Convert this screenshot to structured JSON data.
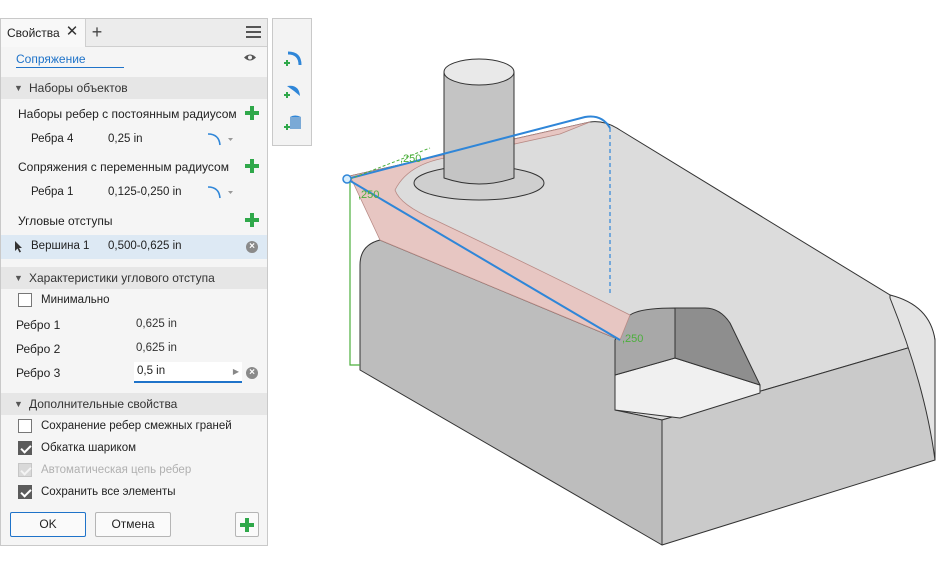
{
  "panel": {
    "tab_label": "Свойства",
    "close_glyph": "✕",
    "add_glyph": "+",
    "feature_name": "Сопряжение",
    "sections": {
      "object_sets": "Наборы объектов",
      "corner_setback": "Характеристики углового отступа",
      "advanced": "Дополнительные свойства"
    },
    "const_radius": {
      "title": "Наборы ребер с постоянным радиусом",
      "edge_label": "Ребра 4",
      "edge_value": "0,25 in"
    },
    "var_radius": {
      "title": "Сопряжения с переменным радиусом",
      "edge_label": "Ребра 1",
      "edge_value": "0,125-0,250 in"
    },
    "setbacks": {
      "title": "Угловые отступы",
      "vertex_label": "Вершина 1",
      "vertex_value": "0,500-0,625 in"
    },
    "corner": {
      "minimal_label": "Минимально",
      "minimal_checked": false,
      "edge1_label": "Ребро 1",
      "edge1_value": "0,625 in",
      "edge2_label": "Ребро 2",
      "edge2_value": "0,625 in",
      "edge3_label": "Ребро 3",
      "edge3_value": "0,5 in"
    },
    "advanced": {
      "preserve_edges_label": "Сохранение ребер смежных граней",
      "preserve_edges_checked": false,
      "rolling_ball_label": "Обкатка шариком",
      "rolling_ball_checked": true,
      "auto_chain_label": "Автоматическая цепь ребер",
      "auto_chain_checked": true,
      "auto_chain_disabled": true,
      "keep_all_label": "Сохранить все элементы",
      "keep_all_checked": true
    },
    "buttons": {
      "ok": "OK",
      "cancel": "Отмена"
    }
  },
  "viewport": {
    "dim_labels": [
      ",250",
      ",250",
      ",250"
    ],
    "colors": {
      "accent": "#1f73c9",
      "add_green": "#2fa84a",
      "model_face": "#d2d2d2",
      "fillet_tint": "#e7c6c2",
      "selection_blue": "#2f86d8",
      "dimension_green": "#4caf3c"
    }
  }
}
